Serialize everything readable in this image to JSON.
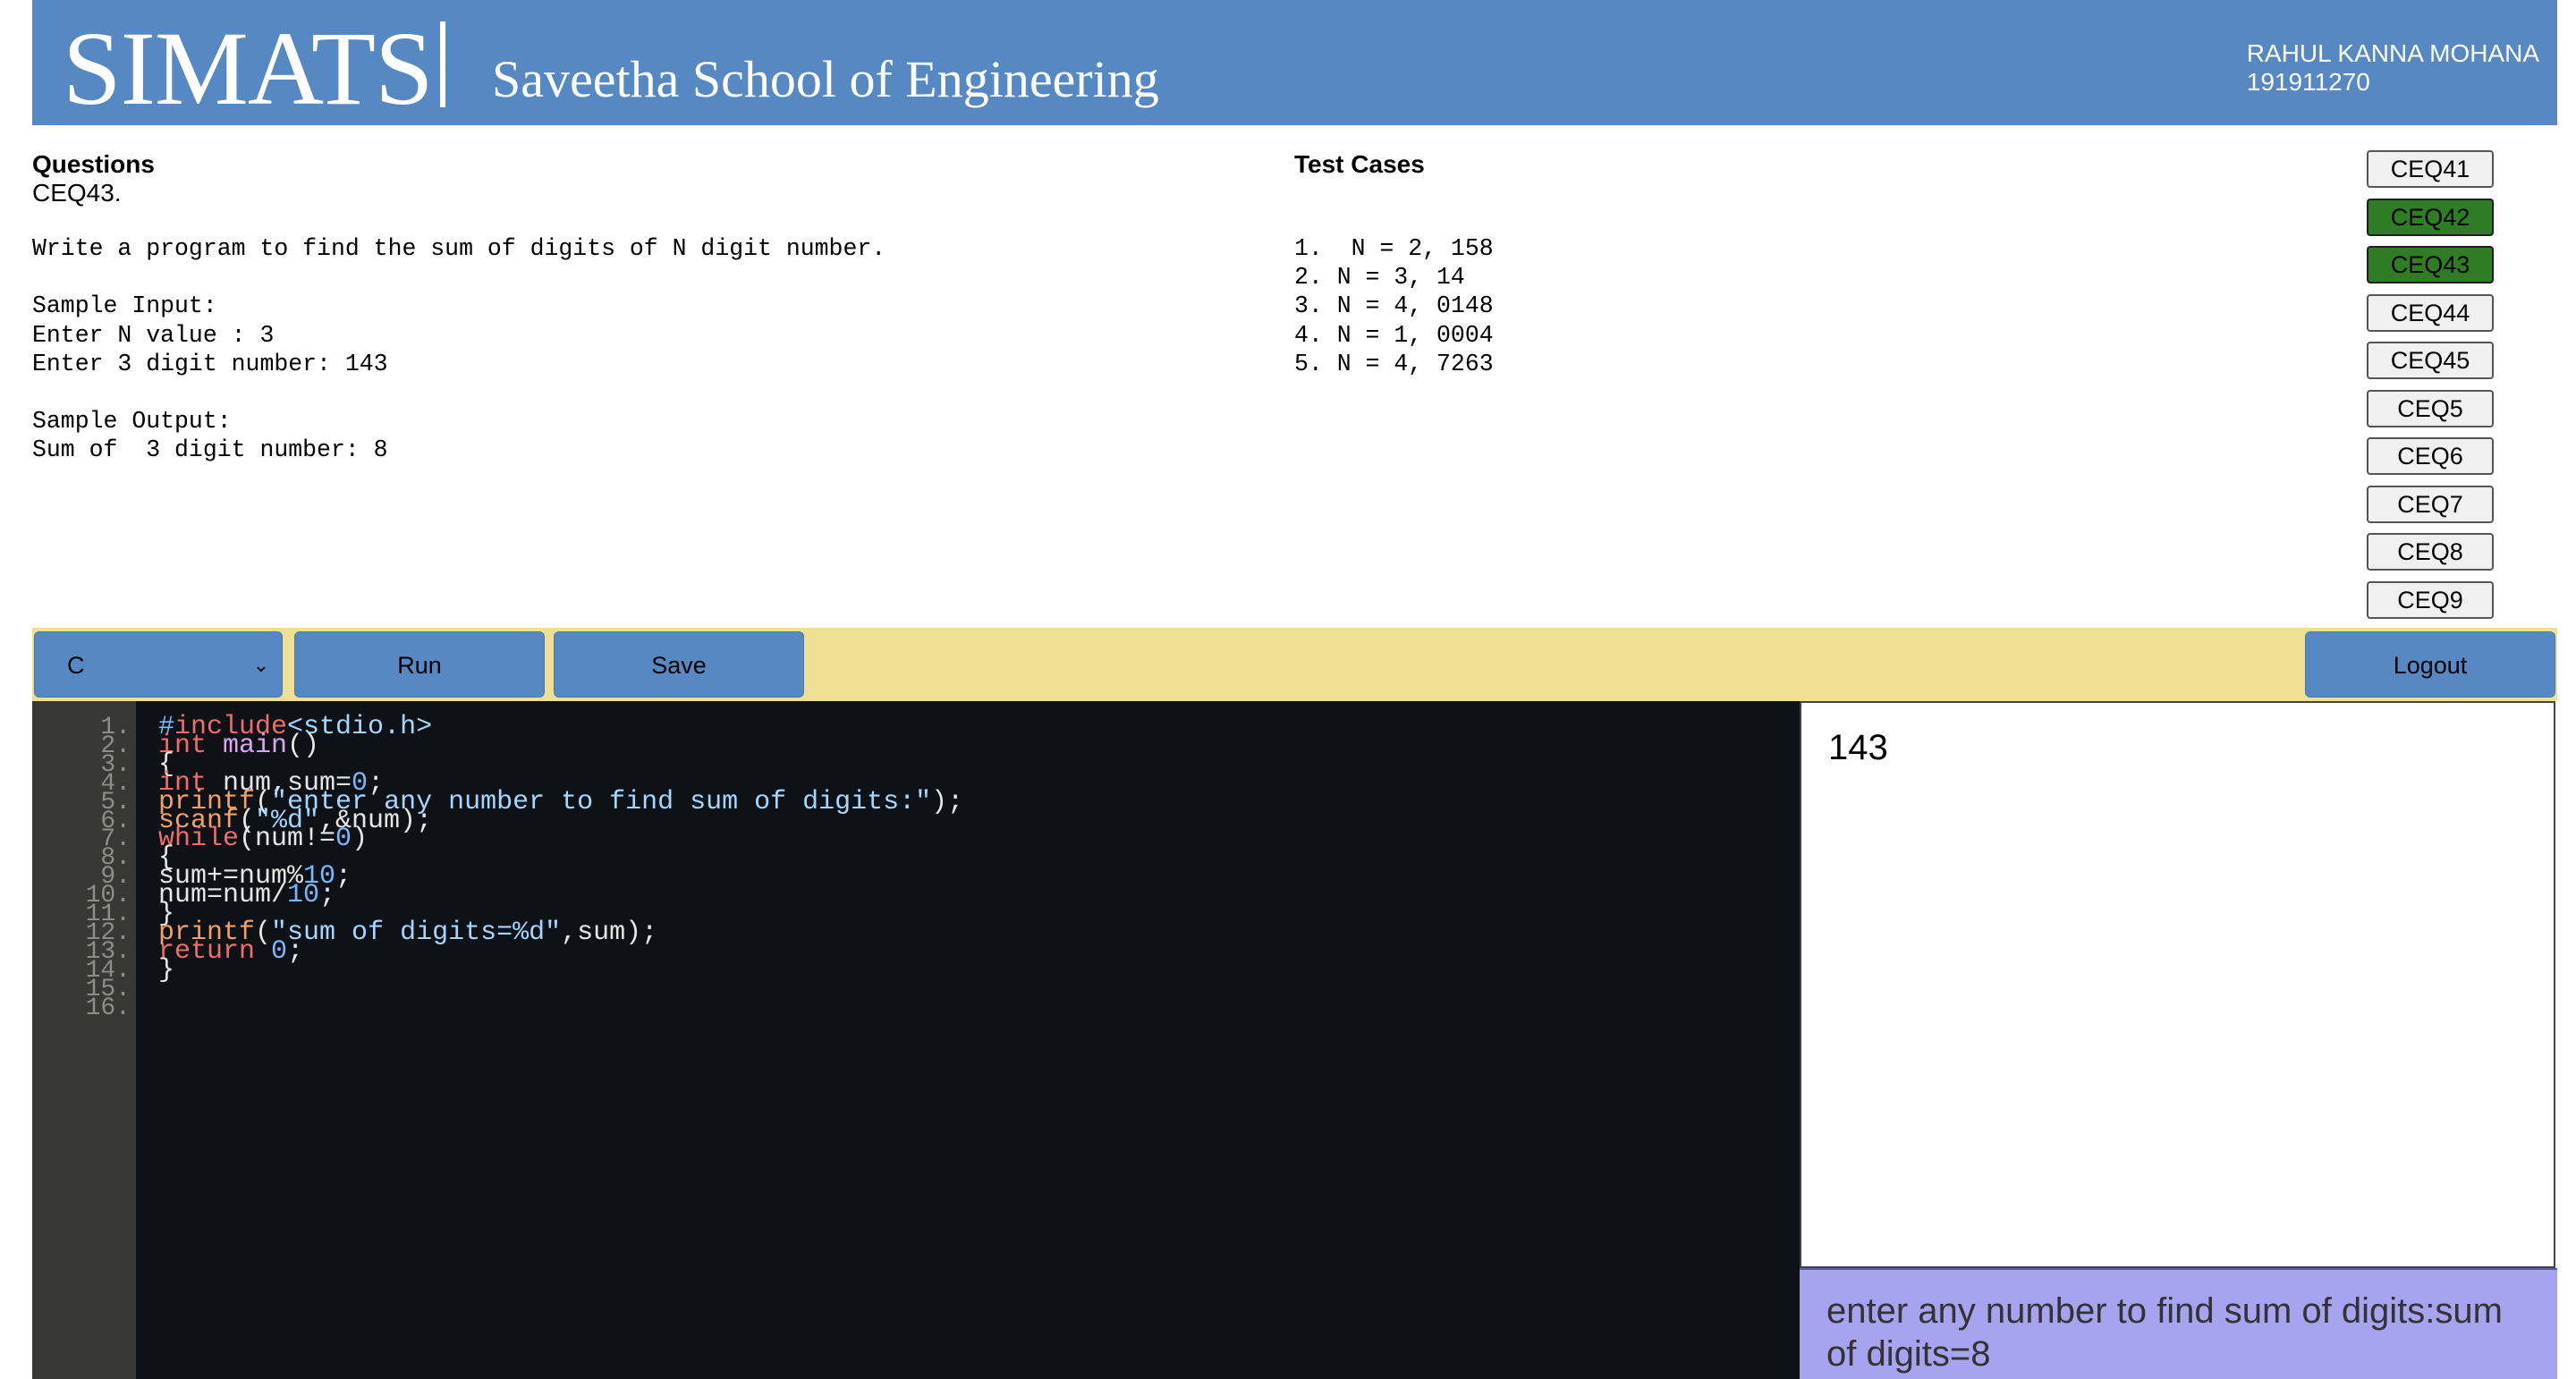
{
  "header": {
    "logo": "SIMATS",
    "school": "Saveetha School of Engineering",
    "user_name": "RAHUL KANNA MOHANA",
    "user_id": "191911270"
  },
  "question": {
    "heading": "Questions",
    "code": "CEQ43.",
    "body": "Write a program to find the sum of digits of N digit number.\n\nSample Input:\nEnter N value : 3\nEnter 3 digit number: 143\n\nSample Output:\nSum of  3 digit number: 8"
  },
  "test_cases": {
    "heading": "Test Cases",
    "items": [
      "1.  N = 2, 158",
      "2. N = 3, 14",
      "3. N = 4, 0148",
      "4. N = 1, 0004",
      "5. N = 4, 7263"
    ]
  },
  "question_list": [
    {
      "label": "CEQ41",
      "done": false
    },
    {
      "label": "CEQ42",
      "done": true
    },
    {
      "label": "CEQ43",
      "done": true
    },
    {
      "label": "CEQ44",
      "done": false
    },
    {
      "label": "CEQ45",
      "done": false
    },
    {
      "label": "CEQ5",
      "done": false
    },
    {
      "label": "CEQ6",
      "done": false
    },
    {
      "label": "CEQ7",
      "done": false
    },
    {
      "label": "CEQ8",
      "done": false
    },
    {
      "label": "CEQ9",
      "done": false
    },
    {
      "label": "",
      "done": false
    }
  ],
  "toolbar": {
    "language": "C",
    "run_label": "Run",
    "save_label": "Save",
    "logout_label": "Logout"
  },
  "editor": {
    "line_numbers": [
      "1.",
      "2.",
      "3.",
      "4.",
      "5.",
      "6.",
      "7.",
      "8.",
      "9.",
      "10.",
      "11.",
      "12.",
      "13.",
      "14.",
      "15.",
      "16."
    ],
    "lines": [
      [
        [
          "pp",
          "#"
        ],
        [
          "k",
          "include"
        ],
        [
          "s",
          "<stdio.h>"
        ]
      ],
      [
        [
          "k",
          "int"
        ],
        [
          "t",
          " "
        ],
        [
          "f",
          "main"
        ],
        [
          "t",
          "()"
        ]
      ],
      [
        [
          "t",
          "{"
        ]
      ],
      [
        [
          "k",
          "int"
        ],
        [
          "t",
          " num,sum="
        ],
        [
          "n",
          "0"
        ],
        [
          "t",
          ";"
        ]
      ],
      [
        [
          "fn",
          "printf"
        ],
        [
          "t",
          "("
        ],
        [
          "s",
          "\"enter any number to find sum of digits:\""
        ],
        [
          "t",
          ");"
        ]
      ],
      [
        [
          "fn",
          "scanf"
        ],
        [
          "t",
          "("
        ],
        [
          "s",
          "\"%d\""
        ],
        [
          "t",
          ",&num);"
        ]
      ],
      [
        [
          "k",
          "while"
        ],
        [
          "t",
          "(num!="
        ],
        [
          "n",
          "0"
        ],
        [
          "t",
          ")"
        ]
      ],
      [
        [
          "t",
          "{"
        ]
      ],
      [
        [
          "t",
          "sum+=num%"
        ],
        [
          "n",
          "10"
        ],
        [
          "t",
          ";"
        ]
      ],
      [
        [
          "t",
          "num=num/"
        ],
        [
          "n",
          "10"
        ],
        [
          "t",
          ";"
        ]
      ],
      [
        [
          "t",
          "}"
        ]
      ],
      [
        [
          "fn",
          "printf"
        ],
        [
          "t",
          "("
        ],
        [
          "s",
          "\"sum of digits=%d\""
        ],
        [
          "t",
          ",sum);"
        ]
      ],
      [
        [
          "k",
          "return"
        ],
        [
          "t",
          " "
        ],
        [
          "n",
          "0"
        ],
        [
          "t",
          ";"
        ]
      ],
      [
        [
          "t",
          "}"
        ]
      ],
      [],
      []
    ]
  },
  "input_box": {
    "value": "143"
  },
  "output_box": {
    "value": "enter any number to find sum of digits:sum of digits=8"
  }
}
